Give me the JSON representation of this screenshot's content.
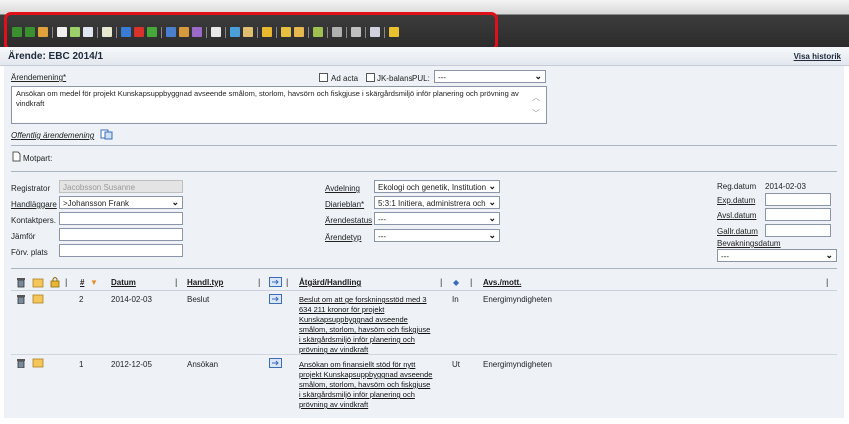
{
  "header": {
    "case_title": "Ärende: EBC 2014/1",
    "history_link": "Visa historik"
  },
  "toolbar": {
    "icons": [
      {
        "name": "save-icon",
        "color": "#3a8f2e"
      },
      {
        "name": "save-close-icon",
        "color": "#3a8f2e"
      },
      {
        "name": "folder-icon",
        "color": "#e0a13a"
      },
      {
        "name": "new-document-icon",
        "color": "#f0f0f0"
      },
      {
        "name": "edit-document-icon",
        "color": "#9ccf6a"
      },
      {
        "name": "copy-document-icon",
        "color": "#dfe6f0"
      },
      {
        "name": "report-icon",
        "color": "#e8e8d0"
      },
      {
        "name": "arrow-blue-icon",
        "color": "#3a7bd5"
      },
      {
        "name": "arrow-red-icon",
        "color": "#d8322b"
      },
      {
        "name": "arrow-green-icon",
        "color": "#46a83a"
      },
      {
        "name": "card-icon",
        "color": "#4a7fd0"
      },
      {
        "name": "users-icon",
        "color": "#d79a3a"
      },
      {
        "name": "cube-icon",
        "color": "#9a6ac8"
      },
      {
        "name": "list-icon",
        "color": "#e8e8e8"
      },
      {
        "name": "export-icon",
        "color": "#4aa0d8"
      },
      {
        "name": "chat-icon",
        "color": "#e0c070"
      },
      {
        "name": "lock-icon",
        "color": "#e8b830"
      },
      {
        "name": "dollar-icon",
        "color": "#e8c040"
      },
      {
        "name": "folders-icon",
        "color": "#e8b850"
      },
      {
        "name": "tools-icon",
        "color": "#a0c050"
      },
      {
        "name": "refresh-icon",
        "color": "#b0b0b0"
      },
      {
        "name": "search-icon",
        "color": "#c0c0c0"
      },
      {
        "name": "checklist-icon",
        "color": "#d0d0e0"
      },
      {
        "name": "help-icon",
        "color": "#e8c030"
      }
    ]
  },
  "form": {
    "arendemening_label": "Ärendemening*",
    "ad_acta_label": "Ad acta",
    "jk_balans_label": "JK-balans",
    "pul_label": "PUL:",
    "pul_value": "---",
    "description": "Ansökan om medel för projekt Kunskapsuppbyggnad avseende smålom, storlom, havsörn och fiskgjuse i skärgårdsmiljö inför planering och prövning av vindkraft",
    "public_desc_label": "Offentlig ärendemening",
    "motpart_label": "Motpart:",
    "registrator_label": "Registrator",
    "registrator_value": "Jacobsson Susanne",
    "handlaggare_label": "Handläggare",
    "handlaggare_value": ">Johansson Frank",
    "kontaktpers_label": "Kontaktpers.",
    "jamfor_label": "Jämför",
    "forv_plats_label": "Förv. plats",
    "avdelning_label": "Avdelning",
    "avdelning_value": "Ekologi och genetik, Institution",
    "diarieblan_label": "Diarieblan*",
    "diarieblan_value": "5:3:1 Initiera, administrera och",
    "arendestatus_label": "Ärendestatus",
    "arendestatus_value": "---",
    "arendetyp_label": "Ärendetyp",
    "arendetyp_value": "---",
    "regdatum_label": "Reg.datum",
    "regdatum_value": "2014-02-03",
    "expdatum_label": "Exp.datum",
    "avsldatum_label": "Avsl.datum",
    "gallrdatum_label": "Gallr.datum",
    "bevakningsdatum_label": "Bevakningsdatum",
    "bevakningsdatum_value": "---"
  },
  "table": {
    "headers": {
      "num": "#",
      "datum": "Datum",
      "handltyp": "Handl.typ",
      "atgard": "Åtgärd/Handling",
      "avs": "Avs./mott."
    },
    "rows": [
      {
        "num": "2",
        "datum": "2014-02-03",
        "handltyp": "Beslut",
        "atgard": "Beslut om att ge forskningsstöd med 3 634 211 kronor för projekt Kunskapsuppbyggnad avseende smålom, storlom, havsörn och fiskgjuse i skärgårdsmiljö inför planering och prövning av vindkraft",
        "direction": "In",
        "avs": "Energimyndigheten"
      },
      {
        "num": "1",
        "datum": "2012-12-05",
        "handltyp": "Ansökan",
        "atgard": "Ansökan om finansiellt stöd för nytt projekt Kunskapsuppbyggnad avseende smålom, storlom, havsörn och fiskgjuse i skärgårdsmiljö inför planering och prövning av vindkraft",
        "direction": "Ut",
        "avs": "Energimyndigheten"
      }
    ]
  },
  "colors": {
    "highlight": "#e0101a",
    "panel": "#eef2f7",
    "sort_arrow": "#e8902a"
  }
}
